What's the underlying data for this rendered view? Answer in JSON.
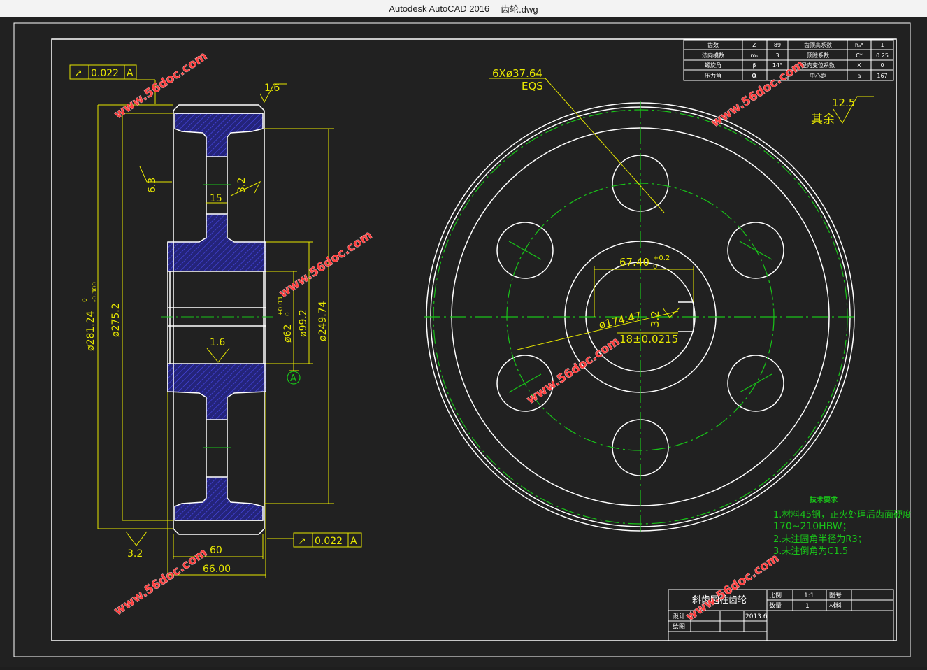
{
  "window": {
    "title_app": "Autodesk AutoCAD 2016",
    "title_file": "齿轮.dwg"
  },
  "params_table": {
    "rows": [
      [
        "齿数",
        "Z",
        "89",
        "齿顶高系数",
        "hₐ*",
        "1"
      ],
      [
        "法向模数",
        "mₙ",
        "3",
        "顶隙系数",
        "C*",
        "0.25"
      ],
      [
        "螺旋角",
        "β",
        "14°",
        "径向变位系数",
        "X",
        "0"
      ],
      [
        "压力角",
        "α",
        "",
        "中心距",
        "a",
        "167"
      ]
    ]
  },
  "side_view": {
    "tolerance_frame_top": {
      "symbol": "↗",
      "value": "0.022",
      "datum": "A"
    },
    "tolerance_frame_bottom": {
      "symbol": "↗",
      "value": "0.022",
      "datum": "A"
    },
    "roughness": [
      "1.6",
      "6.3",
      "3.2",
      "1.6",
      "3.2"
    ],
    "dims": {
      "tip_dia": "ø281.24",
      "tip_tol_upper": "0",
      "tip_tol_lower": "-0.300",
      "ref_dia": "ø275.2",
      "root_dia": "ø249.74",
      "hub_dia": "ø99.2",
      "bore_dia": "ø62",
      "bore_tol": "+0.03",
      "bore_tol_lower": "0",
      "web_width": "15",
      "hub_width": "60",
      "face_width": "66.00"
    },
    "datum_label": "A"
  },
  "front_view": {
    "holes_note": "6Xø37.64",
    "holes_note2": "EQS",
    "keyway_width": "67.40",
    "keyway_width_tol_upper": "+0.2",
    "keyway_width_tol_lower": "0",
    "keyway_roughness": "3.2",
    "key_dim": "18±0.0215",
    "pitch_circle": "ø174.47"
  },
  "other_roughness": {
    "label": "其余",
    "value": "12.5"
  },
  "tech_requirements": {
    "title": "技术要求",
    "lines": [
      "1.材料45钢，正火处理后齿面硬度",
      "170~210HBW；",
      "2.未注圆角半径为R3；",
      "3.未注倒角为C1.5"
    ]
  },
  "title_block": {
    "part_name": "斜齿圆柱齿轮",
    "scale_label": "比例",
    "scale_value": "1:1",
    "drawing_no_label": "图号",
    "qty_label": "数量",
    "qty_value": "1",
    "material_label": "材料",
    "design_label": "设计",
    "design_date": "2013.6",
    "drawing_label": "绘图"
  },
  "watermark": "www.56doc.com",
  "colors": {
    "background": "#212121",
    "lines": "#ffffff",
    "dimension": "#e8e800",
    "center": "#19c419",
    "hatch": "#2b2bd8",
    "watermark": "#ff3030"
  }
}
